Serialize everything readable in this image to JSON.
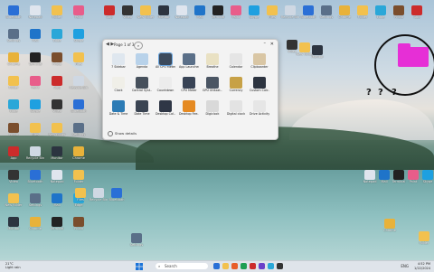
{
  "gadgets_window": {
    "page_label": "Page 1 of 3",
    "nav_glyph": "◀ ▶",
    "search_glyph": "⌕",
    "minimize_glyph": "–",
    "close_glyph": "✕",
    "tiles": [
      {
        "label": "7 Sidebar",
        "color": "#dfe7ef"
      },
      {
        "label": "Agenda",
        "color": "#b8d2ea"
      },
      {
        "label": "All CPU Meter",
        "color": "#3c4a5c"
      },
      {
        "label": "App Launcher",
        "color": "#5a6f88"
      },
      {
        "label": "Breathe",
        "color": "#e9e1c3"
      },
      {
        "label": "Calendar",
        "color": "#e5e5e5"
      },
      {
        "label": "Clipboarder",
        "color": "#d9c6a4"
      },
      {
        "label": "Clock",
        "color": "#f0efe8"
      },
      {
        "label": "Control Syst...",
        "color": "#46505c"
      },
      {
        "label": "Countdown",
        "color": "#ececec"
      },
      {
        "label": "CPU Meter",
        "color": "#384355"
      },
      {
        "label": "GPU Utilizat...",
        "color": "#4a5563"
      },
      {
        "label": "Currency",
        "color": "#c7a146"
      },
      {
        "label": "Custom Calc...",
        "color": "#2d3440"
      },
      {
        "label": "Date & Time",
        "color": "#2c7bb5"
      },
      {
        "label": "Date Time",
        "color": "#3a4452"
      },
      {
        "label": "Desktop Cal...",
        "color": "#2f3746"
      },
      {
        "label": "Desktop Fee...",
        "color": "#e58a22"
      },
      {
        "label": "Digiclock",
        "color": "#d9d9d9"
      },
      {
        "label": "Digital clock",
        "color": "#e3e3e3"
      },
      {
        "label": "Drive Activity",
        "color": "#e6e6e6"
      }
    ],
    "show_details": "Show details"
  },
  "question_marks": [
    "?",
    "?",
    "?"
  ],
  "desktop_icons": [
    {
      "label": "Bluetooth",
      "color": "#2a6fd6"
    },
    {
      "label": "Settings",
      "color": "#5a6f88"
    },
    {
      "label": "Chrome",
      "color": "#e8b23a"
    },
    {
      "label": "Folder",
      "color": "#f2c14e"
    },
    {
      "label": "Edge",
      "color": "#2aa7d8"
    },
    {
      "label": "Photo",
      "color": "#7a4e2d"
    },
    {
      "label": "App",
      "color": "#cc2b2b"
    },
    {
      "label": "Video",
      "color": "#333333"
    },
    {
      "label": "New folder",
      "color": "#f2c14e"
    },
    {
      "label": "Monitor",
      "color": "#2c3440"
    },
    {
      "label": "Notepad",
      "color": "#dfe5ee"
    },
    {
      "label": "Mail",
      "color": "#1f74c9"
    },
    {
      "label": "Terminal",
      "color": "#222222"
    },
    {
      "label": "Paint",
      "color": "#e85d8a"
    },
    {
      "label": "Skype",
      "color": "#1ea0e0"
    },
    {
      "label": "Files",
      "color": "#f2c14e"
    },
    {
      "label": "Recycle Bin",
      "color": "#cfd8e3"
    }
  ],
  "taskbar": {
    "weather_temp": "21°C",
    "weather_desc": "Light rain",
    "search_placeholder": "Search",
    "search_icon": "⌕",
    "tray": "ENG",
    "time": "4:52 PM",
    "date": "1/22/2024",
    "app_colors": [
      "#2a6fd6",
      "#f2c14e",
      "#e85d2a",
      "#1e9e53",
      "#cc2b2b",
      "#6a3fc9",
      "#2aa7d8",
      "#333333"
    ]
  }
}
